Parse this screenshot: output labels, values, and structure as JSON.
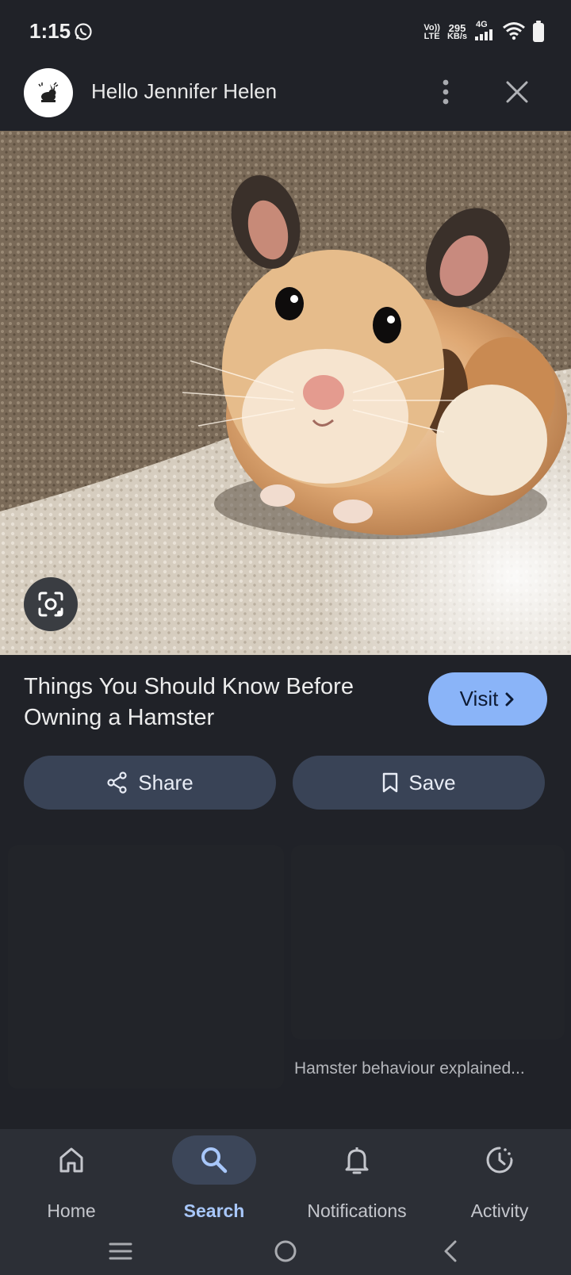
{
  "status_bar": {
    "time": "1:15",
    "volte_top": "Vo))",
    "volte_bottom": "LTE",
    "speed_value": "295",
    "speed_unit": "KB/s",
    "network": "4G",
    "icons": [
      "whatsapp-icon",
      "signal-icon",
      "wifi-icon",
      "battery-icon"
    ]
  },
  "header": {
    "greeting": "Hello Jennifer Helen",
    "icons": [
      "bunny-avatar-icon",
      "more-vert-icon",
      "close-icon"
    ]
  },
  "pin": {
    "image_subject": "hamster",
    "title": "Things You Should Know Before Owning a Hamster",
    "visit_label": "Visit",
    "share_label": "Share",
    "save_label": "Save"
  },
  "related": {
    "caption": "Hamster behaviour explained..."
  },
  "bottom_nav": {
    "items": [
      {
        "label": "Home",
        "icon": "home-icon",
        "active": false
      },
      {
        "label": "Search",
        "icon": "search-icon",
        "active": true
      },
      {
        "label": "Notifications",
        "icon": "bell-icon",
        "active": false
      },
      {
        "label": "Activity",
        "icon": "activity-icon",
        "active": false
      }
    ]
  },
  "colors": {
    "background": "#202228",
    "accent": "#8ab4f8",
    "button": "#394356",
    "nav_bar": "#2c2f36",
    "active_label": "#a8c7fa"
  }
}
